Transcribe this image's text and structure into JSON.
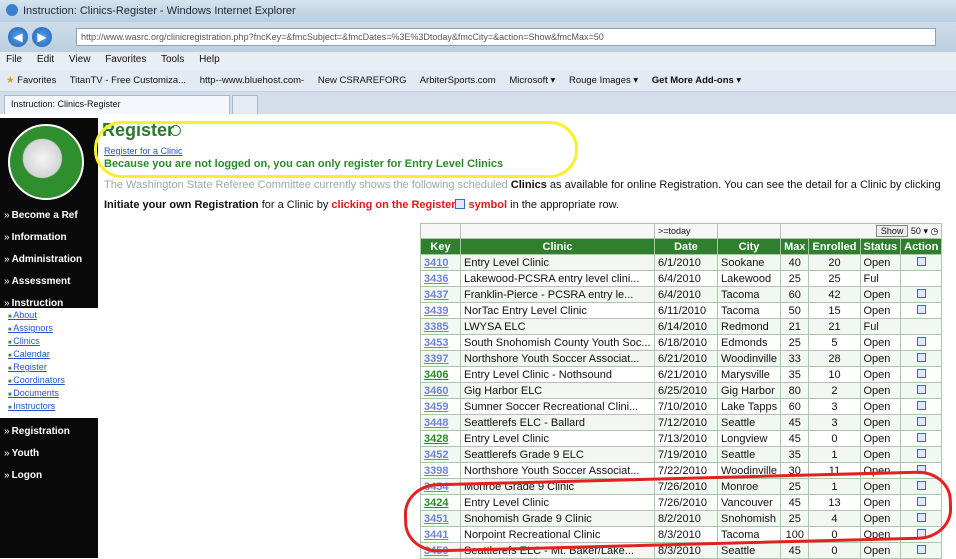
{
  "window": {
    "title": "Instruction: Clinics-Register - Windows Internet Explorer",
    "address": "http://www.wasrc.org/clinicregistration.php?fncKey=&fmcSubject=&fmcDates=%3E%3Dtoday&fmcCity=&action=Show&fmcMax=50"
  },
  "menubar": [
    "File",
    "Edit",
    "View",
    "Favorites",
    "Tools",
    "Help"
  ],
  "favorites_label": "Favorites",
  "favbar": [
    "TitanTV - Free Customiza...",
    "http--www.bluehost.com-",
    "New CSRAREFORG",
    "ArbiterSports.com",
    "Microsoft ▾",
    "Rouge Images ▾",
    "Get More Add-ons ▾"
  ],
  "tab": {
    "title": "Instruction: Clinics-Register"
  },
  "sidebar": {
    "sections": [
      "Become a Ref",
      "Information",
      "Administration",
      "Assessment",
      "Instruction"
    ],
    "subnav": [
      "About",
      "Assignors",
      "Clinics",
      "Calendar",
      "Register",
      "Coordinators",
      "Documents",
      "Instructors"
    ],
    "sections_bottom": [
      "Registration",
      "Youth",
      "Logon"
    ]
  },
  "page": {
    "heading": "Register",
    "register_link": "Register for a Clinic",
    "warning": "Because you are not logged on, you can only register for Entry Level Clinics",
    "intro1_start": "The Washington State Referee Committee currently shows the following scheduled ",
    "intro1_bold": "Clinics",
    "intro1_end": " as available for online Registration. You can see the detail for a Clinic by clicking",
    "intro2_start": "Initiate your own ",
    "intro2_bold": "Registration",
    "intro2_mid": " for a Clinic by ",
    "intro2_red": "clicking on the Register",
    "intro2_red2": " symbol",
    "intro2_end": " in the appropriate row."
  },
  "filter": {
    "date": ">=today",
    "show": "Show",
    "max": "50"
  },
  "table": {
    "headers": [
      "Key",
      "Clinic",
      "Date",
      "City",
      "Max",
      "Enrolled",
      "Status",
      "Action"
    ],
    "rows": [
      {
        "key": "3410",
        "clinic": "Entry Level Clinic",
        "date": "6/1/2010",
        "city": "Sookane",
        "max": "40",
        "enrolled": "20",
        "status": "Open",
        "action": true
      },
      {
        "key": "3436",
        "clinic": "Lakewood-PCSRA entry level clini...",
        "date": "6/4/2010",
        "city": "Lakewood",
        "max": "25",
        "enrolled": "25",
        "status": "Ful",
        "action": false
      },
      {
        "key": "3437",
        "clinic": "Franklin-Pierce - PCSRA entry le...",
        "date": "6/4/2010",
        "city": "Tacoma",
        "max": "60",
        "enrolled": "42",
        "status": "Open",
        "action": true
      },
      {
        "key": "3439",
        "clinic": "NorTac Entry Level Clinic",
        "date": "6/11/2010",
        "city": "Tacoma",
        "max": "50",
        "enrolled": "15",
        "status": "Open",
        "action": true
      },
      {
        "key": "3385",
        "clinic": "LWYSA ELC",
        "date": "6/14/2010",
        "city": "Redmond",
        "max": "21",
        "enrolled": "21",
        "status": "Ful",
        "action": false
      },
      {
        "key": "3453",
        "clinic": "South Snohomish County Youth Soc...",
        "date": "6/18/2010",
        "city": "Edmonds",
        "max": "25",
        "enrolled": "5",
        "status": "Open",
        "action": true
      },
      {
        "key": "3397",
        "clinic": "Northshore Youth Soccer Associat...",
        "date": "6/21/2010",
        "city": "Woodinville",
        "max": "33",
        "enrolled": "28",
        "status": "Open",
        "action": true
      },
      {
        "key": "3406",
        "clinic": "Entry Level Clinic - Nothsound",
        "date": "6/21/2010",
        "city": "Marysville",
        "max": "35",
        "enrolled": "10",
        "status": "Open",
        "action": true,
        "green": true
      },
      {
        "key": "3460",
        "clinic": "Gig Harbor ELC",
        "date": "6/25/2010",
        "city": "Gig Harbor",
        "max": "80",
        "enrolled": "2",
        "status": "Open",
        "action": true
      },
      {
        "key": "3459",
        "clinic": "Sumner Soccer Recreational Clini...",
        "date": "7/10/2010",
        "city": "Lake Tapps",
        "max": "60",
        "enrolled": "3",
        "status": "Open",
        "action": true
      },
      {
        "key": "3448",
        "clinic": "Seattlerefs ELC - Ballard",
        "date": "7/12/2010",
        "city": "Seattle",
        "max": "45",
        "enrolled": "3",
        "status": "Open",
        "action": true
      },
      {
        "key": "3428",
        "clinic": "Entry Level Clinic",
        "date": "7/13/2010",
        "city": "Longview",
        "max": "45",
        "enrolled": "0",
        "status": "Open",
        "action": true,
        "green": true
      },
      {
        "key": "3452",
        "clinic": "Seattlerefs Grade 9 ELC",
        "date": "7/19/2010",
        "city": "Seattle",
        "max": "35",
        "enrolled": "1",
        "status": "Open",
        "action": true
      },
      {
        "key": "3398",
        "clinic": "Northshore Youth Soccer Associat...",
        "date": "7/22/2010",
        "city": "Woodinville",
        "max": "30",
        "enrolled": "11",
        "status": "Open",
        "action": true
      },
      {
        "key": "3454",
        "clinic": "Monroe Grade 9 Clinic",
        "date": "7/26/2010",
        "city": "Monroe",
        "max": "25",
        "enrolled": "1",
        "status": "Open",
        "action": true
      },
      {
        "key": "3424",
        "clinic": "Entry Level Clinic",
        "date": "7/26/2010",
        "city": "Vancouver",
        "max": "45",
        "enrolled": "13",
        "status": "Open",
        "action": true,
        "green": true
      },
      {
        "key": "3451",
        "clinic": "Snohomish Grade 9 Clinic",
        "date": "8/2/2010",
        "city": "Snohomish",
        "max": "25",
        "enrolled": "4",
        "status": "Open",
        "action": true
      },
      {
        "key": "3441",
        "clinic": "Norpoint Recreational Clinic",
        "date": "8/3/2010",
        "city": "Tacoma",
        "max": "100",
        "enrolled": "0",
        "status": "Open",
        "action": true
      },
      {
        "key": "3450",
        "clinic": "Seattlerefs ELC - Mt. Baker/Lake...",
        "date": "8/3/2010",
        "city": "Seattle",
        "max": "45",
        "enrolled": "0",
        "status": "Open",
        "action": true
      }
    ]
  },
  "colors": {
    "highlight_yellow": "#f7f02a",
    "highlight_red": "#e52020",
    "header_green": "#2f7f2f"
  }
}
